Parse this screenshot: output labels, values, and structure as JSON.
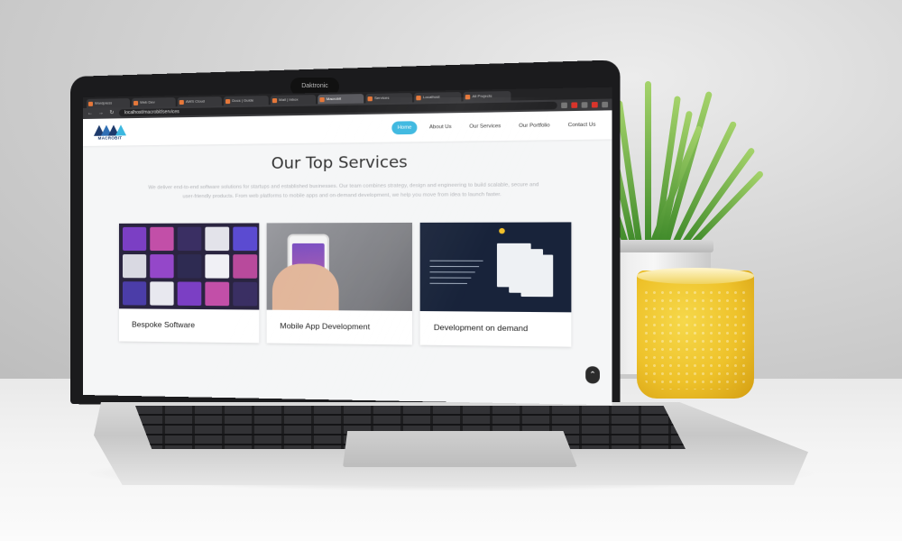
{
  "scene": {
    "camera_label": "Daktronic",
    "colors": {
      "wall": "#d4d4d4",
      "desk": "#f3f3f3",
      "laptop": "#1b1b1d",
      "mug": "#eec22a",
      "plant": "#5fa83a"
    }
  },
  "browser": {
    "tabs": [
      {
        "label": "Wordpress",
        "icon": "wordpress-icon"
      },
      {
        "label": "Web Dev",
        "icon": "app-icon"
      },
      {
        "label": "AWS Cloud",
        "icon": "app-icon"
      },
      {
        "label": "Docs | Guide",
        "icon": "doc-icon"
      },
      {
        "label": "Mail | Inbox",
        "icon": "mail-icon"
      },
      {
        "label": "Macrobit",
        "icon": "site-icon",
        "active": true
      },
      {
        "label": "Services",
        "icon": "app-icon"
      },
      {
        "label": "Localhost",
        "icon": "app-icon"
      },
      {
        "label": "All Projects",
        "icon": "app-icon"
      }
    ],
    "address": "localhost/macrobit/services"
  },
  "site": {
    "logo_text": "MACROBIT",
    "nav": [
      {
        "label": "Home",
        "active": true
      },
      {
        "label": "About Us",
        "active": false
      },
      {
        "label": "Our Services",
        "active": false
      },
      {
        "label": "Our Portfolio",
        "active": false
      },
      {
        "label": "Contact Us",
        "active": false
      }
    ],
    "accent": "#3cb8e0"
  },
  "content": {
    "title": "Our Top Services",
    "description": "We deliver end-to-end software solutions for startups and established businesses. Our team combines strategy, design and engineering to build scalable, secure and user-friendly products. From web platforms to mobile apps and on-demand development, we help you move from idea to launch faster.",
    "cards": [
      {
        "label": "Bespoke Software"
      },
      {
        "label": "Mobile App Development"
      },
      {
        "label": "Development on demand"
      }
    ],
    "scroll_top_icon": "chevron-up-icon"
  }
}
